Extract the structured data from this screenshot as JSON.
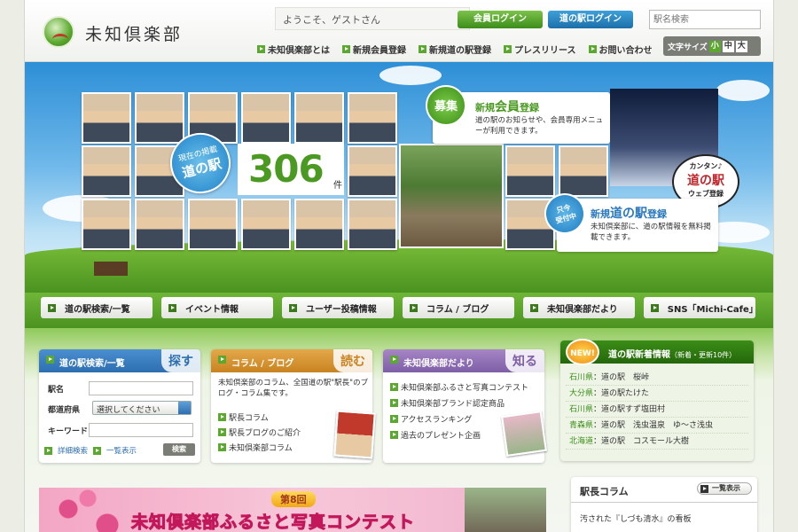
{
  "header": {
    "logo_text": "未知倶楽部",
    "welcome": "ようこそ、ゲストさん",
    "member_login": "会員ログイン",
    "station_login": "道の駅ログイン",
    "search_placeholder": "駅名検索",
    "nav": [
      {
        "label": "未知倶楽部とは"
      },
      {
        "label": "新規会員登録"
      },
      {
        "label": "新規道の駅登録"
      },
      {
        "label": "プレスリリース"
      },
      {
        "label": "お問い合わせ"
      }
    ],
    "font_size": {
      "label": "文字サイズ",
      "small": "小",
      "medium": "中",
      "large": "大"
    }
  },
  "hero": {
    "badge_registered_line1": "現在の掲載",
    "badge_registered_line2": "道の駅",
    "count": "306",
    "count_unit": "件",
    "recruit_badge": "募集",
    "recruit_title_a": "新規",
    "recruit_title_b": "会員",
    "recruit_title_c": "登録",
    "recruit_desc": "道の駅のお知らせや、会員専用メニューが利用できます。",
    "easy_line1": "カンタン♪",
    "easy_line2": "道の駅",
    "easy_line3": "ウェブ登録",
    "now_line1": "只今",
    "now_line2": "受付中",
    "register_title_a": "新規",
    "register_title_b": "道の駅",
    "register_title_c": "登録",
    "register_desc": "未知倶楽部に、道の駅情報を無料掲載できます。"
  },
  "main_nav": [
    {
      "label": "道の駅検索/一覧"
    },
    {
      "label": "イベント情報"
    },
    {
      "label": "ユーザー投稿情報"
    },
    {
      "label": "コラム / ブログ"
    },
    {
      "label": "未知倶楽部だより"
    },
    {
      "label": "SNS「Michi-Cafe」"
    }
  ],
  "search_box": {
    "title": "道の駅検索/一覧",
    "tag": "探す",
    "name_label": "駅名",
    "pref_label": "都道府県",
    "pref_value": "選択してください",
    "keyword_label": "キーワード",
    "detail_link": "詳細検索",
    "list_link": "一覧表示",
    "search_button": "検索"
  },
  "blog_box": {
    "title": "コラム / ブログ",
    "tag": "読む",
    "desc": "未知倶楽部のコラム、全国道の駅\"駅長\"のブログ・コラム集です。",
    "links": [
      "駅長コラム",
      "駅長ブログのご紹介",
      "未知倶楽部コラム"
    ]
  },
  "club_box": {
    "title": "未知倶楽部だより",
    "tag": "知る",
    "links": [
      "未知倶楽部ふるさと写真コンテスト",
      "未知倶楽部ブランド認定商品",
      "アクセスランキング",
      "過去のプレゼント企画"
    ]
  },
  "news_box": {
    "badge": "NEW!",
    "title": "道の駅新着情報",
    "subtitle": "（新着・更新10件）",
    "items": [
      {
        "pref": "石川県",
        "text": "：道の駅　桜峠"
      },
      {
        "pref": "大分県",
        "text": "：道の駅たけた"
      },
      {
        "pref": "石川県",
        "text": "：道の駅すず塩田村"
      },
      {
        "pref": "青森県",
        "text": "：道の駅　浅虫温泉　ゆ〜さ浅虫"
      },
      {
        "pref": "北海道",
        "text": "：道の駅　コスモール大樹"
      }
    ]
  },
  "column_box": {
    "title": "駅長コラム",
    "list_button": "一覧表示",
    "item": "汚された『しづも清水』の看板"
  },
  "banner": {
    "issue": "第8回",
    "title": "未知倶楽部ふるさと写真コンテスト"
  },
  "colors": {
    "brand_green": "#4a9a22",
    "blue": "#2d6fb0",
    "orange": "#c98320",
    "purple": "#7e5ea6"
  }
}
